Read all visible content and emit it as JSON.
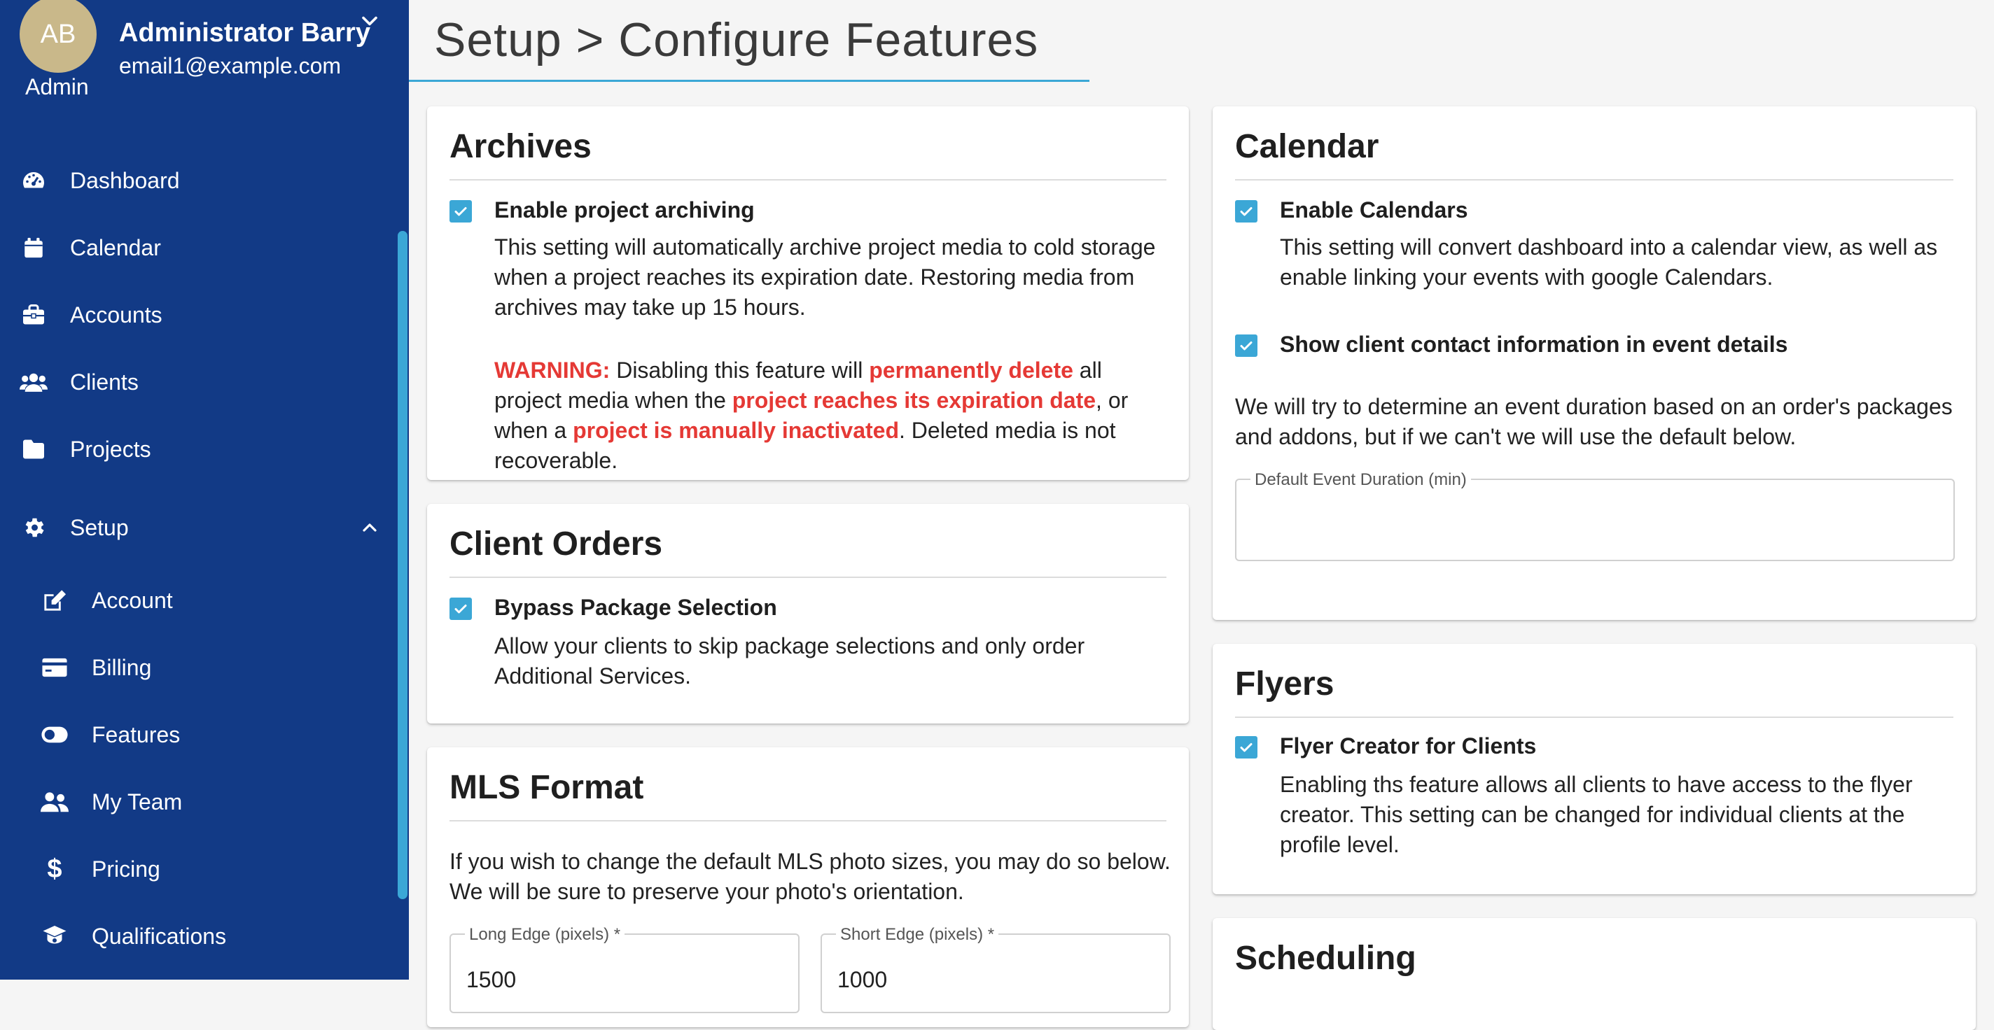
{
  "profile": {
    "initials": "AB",
    "role": "Admin",
    "name": "Administrator Barry",
    "email": "email1@example.com"
  },
  "sidebar": {
    "items": [
      {
        "label": "Dashboard",
        "icon": "gauge-icon"
      },
      {
        "label": "Calendar",
        "icon": "calendar-icon"
      },
      {
        "label": "Accounts",
        "icon": "briefcase-icon"
      },
      {
        "label": "Clients",
        "icon": "users-icon"
      },
      {
        "label": "Projects",
        "icon": "folder-icon"
      }
    ],
    "group": {
      "label": "Setup",
      "icon": "gear-icon",
      "expanded": true
    },
    "subitems": [
      {
        "label": "Account",
        "icon": "edit-icon"
      },
      {
        "label": "Billing",
        "icon": "credit-card-icon"
      },
      {
        "label": "Features",
        "icon": "toggle-icon",
        "active": true
      },
      {
        "label": "My Team",
        "icon": "team-icon"
      },
      {
        "label": "Pricing",
        "icon": "dollar-icon"
      },
      {
        "label": "Qualifications",
        "icon": "graduation-cap-icon"
      }
    ]
  },
  "header": {
    "title": "Setup > Configure Features"
  },
  "colors": {
    "sidebar": "#123a86",
    "accent": "#3ba7d6",
    "warning": "#e53935"
  },
  "archives": {
    "title": "Archives",
    "option_label": "Enable project archiving",
    "option_checked": true,
    "description": "This setting will automatically archive project media to cold storage when a project reaches its expiration date. Restoring media from archives may take up 15 hours.",
    "warning": {
      "prefix": "WARNING:",
      "t1": " Disabling this feature will ",
      "h1": "permanently delete",
      "t2": " all project media when the ",
      "h2": "project reaches its expiration date",
      "t3": ", or when a ",
      "h3": "project is manually inactivated",
      "t4": ". Deleted media is not recoverable."
    }
  },
  "client_orders": {
    "title": "Client Orders",
    "option_label": "Bypass Package Selection",
    "option_checked": true,
    "description": "Allow your clients to skip package selections and only order Additional Services."
  },
  "mls_format": {
    "title": "MLS Format",
    "description": "If you wish to change the default MLS photo sizes, you may do so below. We will be sure to preserve your photo's orientation.",
    "long_edge": {
      "label": "Long Edge (pixels) *",
      "value": "1500"
    },
    "short_edge": {
      "label": "Short Edge (pixels) *",
      "value": "1000"
    }
  },
  "calendar": {
    "title": "Calendar",
    "option1_label": "Enable Calendars",
    "option1_checked": true,
    "option1_description": "This setting will convert dashboard into a calendar view, as well as enable linking your events with google Calendars.",
    "option2_label": "Show client contact information in event details",
    "option2_checked": true,
    "duration_note": "We will try to determine an event duration based on an order's packages and addons, but if we can't we will use the default below.",
    "duration_field": {
      "label": "Default Event Duration (min)",
      "value": ""
    }
  },
  "flyers": {
    "title": "Flyers",
    "option_label": "Flyer Creator for Clients",
    "option_checked": true,
    "description": "Enabling ths feature allows all clients to have access to the flyer creator. This setting can be changed for individual clients at the profile level."
  },
  "scheduling": {
    "title": "Scheduling"
  }
}
